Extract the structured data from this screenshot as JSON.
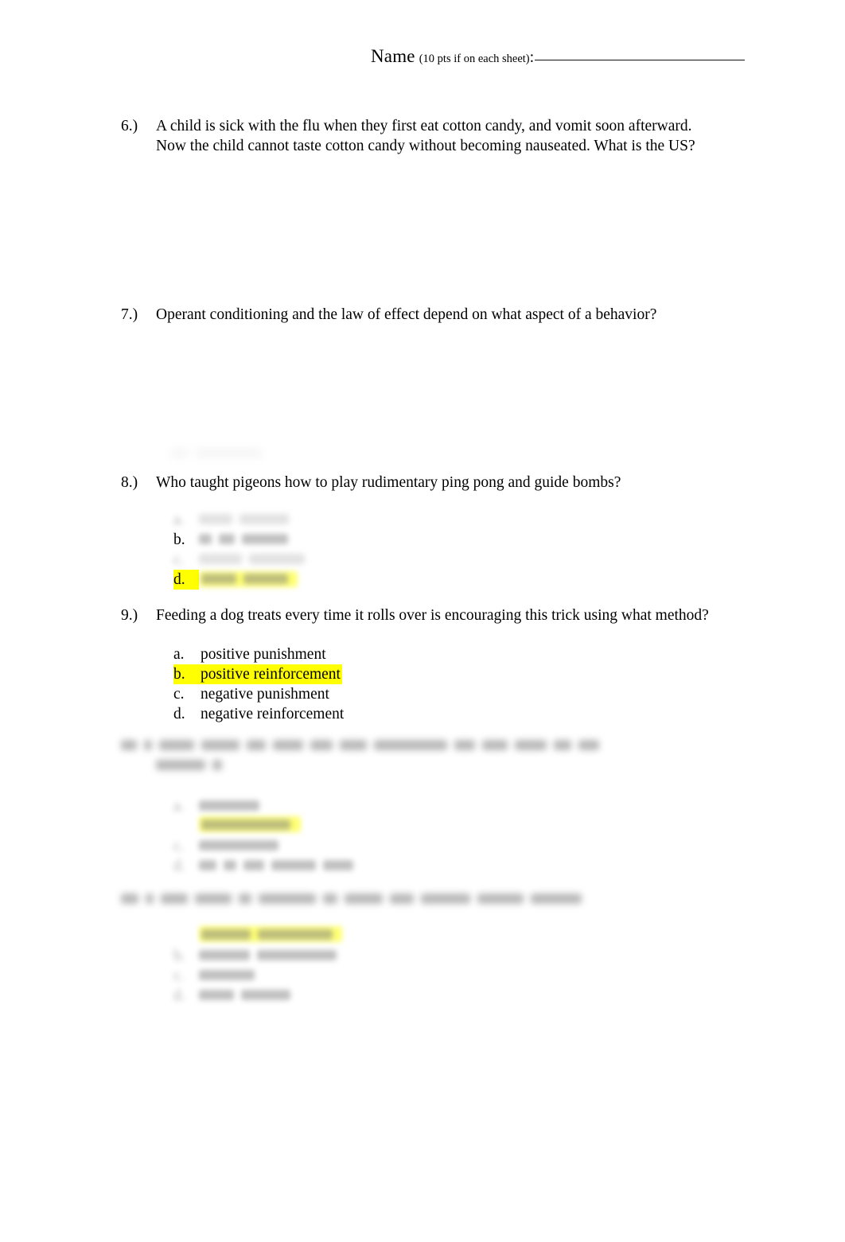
{
  "document": {
    "type": "exam-worksheet",
    "page_background": "#ffffff",
    "highlight_color": "#ffff00",
    "text_color": "#000000"
  },
  "header": {
    "name_label": "Name",
    "points_note": "(10 pts if on each sheet)",
    "colon": ":",
    "answer_line": ""
  },
  "questions": [
    {
      "number": "6.)",
      "text": "A child is sick with the flu when they first eat cotton candy, and vomit soon afterward.\nNow the child cannot taste cotton candy without becoming nauseated.  What is the US?",
      "legible": true,
      "options": []
    },
    {
      "number": "7.)",
      "text": "Operant conditioning and the law of effect depend on what aspect of a behavior?",
      "legible": true,
      "options": []
    },
    {
      "number": "8.)",
      "text": "Who taught pigeons how to play rudimentary ping pong and guide bombs?",
      "legible": true,
      "options": [
        {
          "letter": "a.",
          "text": "",
          "legible": false,
          "highlighted": false
        },
        {
          "letter": "b.",
          "text": "",
          "legible": false,
          "highlighted": false
        },
        {
          "letter": "c.",
          "text": "",
          "legible": false,
          "highlighted": false
        },
        {
          "letter": "d.",
          "text": "",
          "legible": false,
          "highlighted": true
        }
      ]
    },
    {
      "number": "9.)",
      "text": "Feeding a dog treats every time it rolls over is encouraging this trick using what method?",
      "legible": true,
      "options": [
        {
          "letter": "a.",
          "text": "positive punishment",
          "legible": true,
          "highlighted": false
        },
        {
          "letter": "b.",
          "text": "positive reinforcement",
          "legible": true,
          "highlighted": true
        },
        {
          "letter": "c.",
          "text": "negative punishment",
          "legible": true,
          "highlighted": false
        },
        {
          "letter": "d.",
          "text": "negative reinforcement",
          "legible": true,
          "highlighted": false
        }
      ]
    },
    {
      "number": "",
      "text": "",
      "legible": false,
      "options": [
        {
          "letter": "",
          "text": "",
          "legible": false,
          "highlighted": false
        },
        {
          "letter": "",
          "text": "",
          "legible": false,
          "highlighted": true
        },
        {
          "letter": "",
          "text": "",
          "legible": false,
          "highlighted": false
        },
        {
          "letter": "",
          "text": "",
          "legible": false,
          "highlighted": false
        }
      ]
    },
    {
      "number": "",
      "text": "",
      "legible": false,
      "options": [
        {
          "letter": "",
          "text": "",
          "legible": false,
          "highlighted": true
        },
        {
          "letter": "",
          "text": "",
          "legible": false,
          "highlighted": false
        },
        {
          "letter": "",
          "text": "",
          "legible": false,
          "highlighted": false
        },
        {
          "letter": "",
          "text": "",
          "legible": false,
          "highlighted": false
        }
      ]
    }
  ]
}
